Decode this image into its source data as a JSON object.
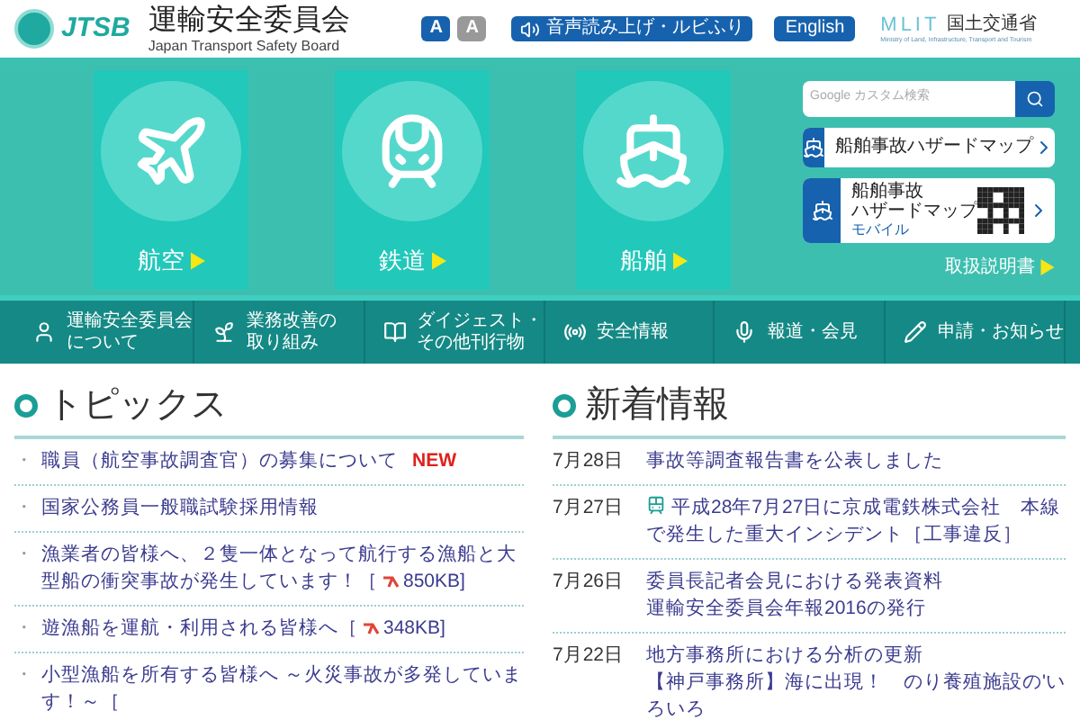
{
  "header": {
    "logo_mark": "JTSB",
    "title": "運輸安全委員会",
    "subtitle": "Japan Transport Safety Board",
    "font_buttons": [
      {
        "label": "A",
        "selected": true
      },
      {
        "label": "A",
        "selected": false
      }
    ],
    "speech_button": "音声読み上げ・ルビふり",
    "english_button": "English",
    "ministry_logo": "MLIT",
    "ministry_name": "国土交通省",
    "ministry_english": "Ministry of Land, Infrastructure, Transport and Tourism"
  },
  "hero": {
    "modes": [
      {
        "kind": "plane",
        "label": "航空"
      },
      {
        "kind": "train",
        "label": "鉄道"
      },
      {
        "kind": "ship",
        "label": "船舶"
      }
    ],
    "search": {
      "placeholder": "Google カスタム検索"
    },
    "hazard_links": [
      {
        "kind": "plain",
        "lines": [
          "船舶事故ハザードマップ"
        ]
      },
      {
        "kind": "mobile",
        "lines": [
          "船舶事故",
          "ハザードマップ"
        ],
        "sublabel": "モバイル"
      }
    ],
    "manual_link": "取扱説明書"
  },
  "nav": [
    {
      "lines": [
        "運輸安全委員会",
        "について"
      ]
    },
    {
      "lines": [
        "業務改善の",
        "取り組み"
      ]
    },
    {
      "lines": [
        "ダイジェスト・",
        "その他刊行物"
      ]
    },
    {
      "lines": [
        "安全情報"
      ]
    },
    {
      "lines": [
        "報道・会見"
      ]
    },
    {
      "lines": [
        "申請・お知らせ"
      ]
    }
  ],
  "topics": {
    "title": "トピックス",
    "items": [
      {
        "bullet": "・",
        "text": "職員（航空事故調査官）の募集について",
        "badge": "NEW"
      },
      {
        "bullet": "・",
        "text": "国家公務員一般職試験採用情報"
      },
      {
        "bullet": "・",
        "text": "漁業者の皆様へ、２隻一体となって航行する漁船と大型船の衝突事故が発生しています！［",
        "file_size": "850KB]"
      },
      {
        "bullet": "・",
        "text": "遊漁船を運航・利用される皆様へ［",
        "file_size": "348KB]"
      },
      {
        "bullet": "・",
        "text": "小型漁船を所有する皆様へ ～火災事故が多発しています！～［"
      }
    ]
  },
  "news": {
    "title": "新着情報",
    "items": [
      {
        "date": "7月28日",
        "lines": [
          {
            "text": "事故等調査報告書を公表しました"
          }
        ]
      },
      {
        "date": "7月27日",
        "lines": [
          {
            "text": "平成28年7月27日に京成電鉄株式会社　本線で発生した重大インシデント［工事違反］",
            "kind": "railway"
          }
        ]
      },
      {
        "date": "7月26日",
        "lines": [
          {
            "text": "委員長記者会見における発表資料"
          },
          {
            "text": "運輸安全委員会年報2016の発行"
          }
        ]
      },
      {
        "date": "7月22日",
        "lines": [
          {
            "text": "地方事務所における分析の更新"
          },
          {
            "text": "【神戸事務所】海に出現！　のり養殖施設の'いろいろ"
          }
        ]
      }
    ]
  }
}
